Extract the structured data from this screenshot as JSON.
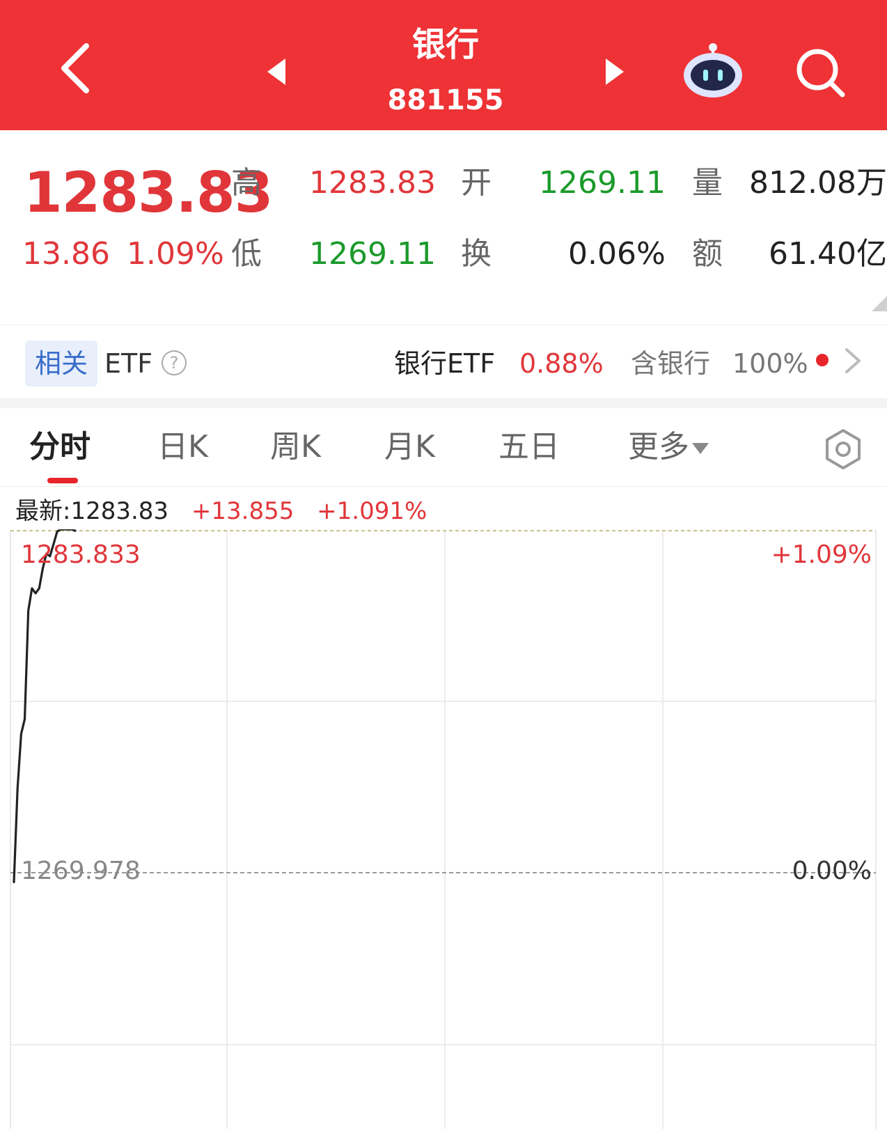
{
  "header": {
    "title": "银行",
    "code": "881155",
    "icons": [
      "back-arrow-icon",
      "prev-triangle-icon",
      "next-triangle-icon",
      "robot-assistant-icon",
      "search-icon"
    ]
  },
  "quote": {
    "price": "1283.83",
    "change": "13.86",
    "change_pct": "1.09%",
    "high_label": "高",
    "high": "1283.83",
    "open_label": "开",
    "open": "1269.11",
    "volume_label": "量",
    "volume": "812.08万",
    "low_label": "低",
    "low": "1269.11",
    "turnover_label": "换",
    "turnover": "0.06%",
    "amount_label": "额",
    "amount": "61.40亿"
  },
  "etf": {
    "tag": "相关",
    "label": "ETF",
    "help": "?",
    "name": "银行ETF",
    "pct": "0.88%",
    "holding_label": "含银行",
    "holding_pct": "100%"
  },
  "tabs": [
    "分时",
    "日K",
    "周K",
    "月K",
    "五日",
    "更多"
  ],
  "active_tab": "分时",
  "latest": {
    "label": "最新:",
    "price": "1283.83",
    "change": "+13.855",
    "change_pct": "+1.091%"
  },
  "colors": {
    "header_red": "#ee3235",
    "up_red": "#e0363a",
    "down_green": "#1a9a2a"
  },
  "chart_data": {
    "type": "line",
    "y_top_label": "1283.833",
    "y_ref_label": "1269.978",
    "pct_top_label": "+1.09%",
    "pct_ref_label": "0.00%",
    "ylim": [
      1269.978,
      1283.833
    ],
    "x_minutes_total": 240,
    "x_minutes": [
      0,
      1,
      2,
      3,
      4,
      5,
      6,
      7,
      8,
      9,
      10,
      11,
      12,
      13,
      14,
      15,
      16,
      17
    ],
    "values": [
      1269.6,
      1273.4,
      1275.6,
      1276.2,
      1280.6,
      1281.5,
      1281.3,
      1281.5,
      1282.3,
      1282.9,
      1282.8,
      1283.3,
      1283.8,
      1283.9,
      1284.0,
      1284.1,
      1284.2,
      1283.83
    ],
    "grid": true
  }
}
